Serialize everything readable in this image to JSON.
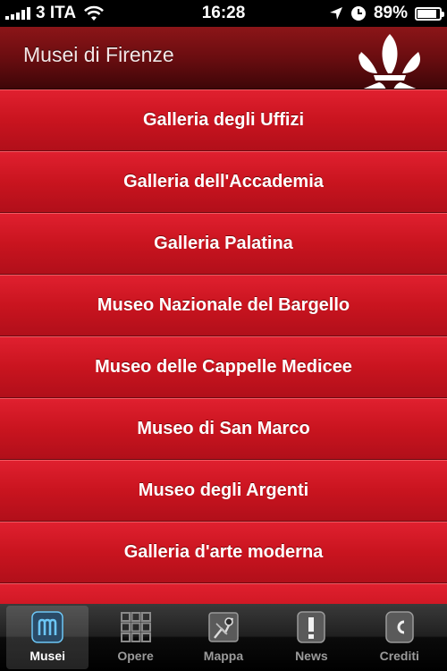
{
  "status_bar": {
    "carrier": "3 ITA",
    "time": "16:28",
    "battery_percent": "89%",
    "battery_level": 0.89
  },
  "header": {
    "title": "Musei di Firenze",
    "logo_icon": "florence-lily-icon"
  },
  "museums": [
    "Galleria degli Uffizi",
    "Galleria dell'Accademia",
    "Galleria Palatina",
    "Museo Nazionale del Bargello",
    "Museo delle Cappelle Medicee",
    "Museo di San Marco",
    "Museo degli Argenti",
    "Galleria d'arte moderna",
    ""
  ],
  "tabs": [
    {
      "label": "Musei",
      "icon": "museum-m-icon",
      "active": true
    },
    {
      "label": "Opere",
      "icon": "grid-icon",
      "active": false
    },
    {
      "label": "Mappa",
      "icon": "map-icon",
      "active": false
    },
    {
      "label": "News",
      "icon": "exclamation-icon",
      "active": false
    },
    {
      "label": "Crediti",
      "icon": "credits-c-icon",
      "active": false
    }
  ],
  "colors": {
    "accent_red": "#c9141f",
    "header_dark_red": "#6a0d10",
    "active_icon_blue": "#4fb8f0"
  }
}
